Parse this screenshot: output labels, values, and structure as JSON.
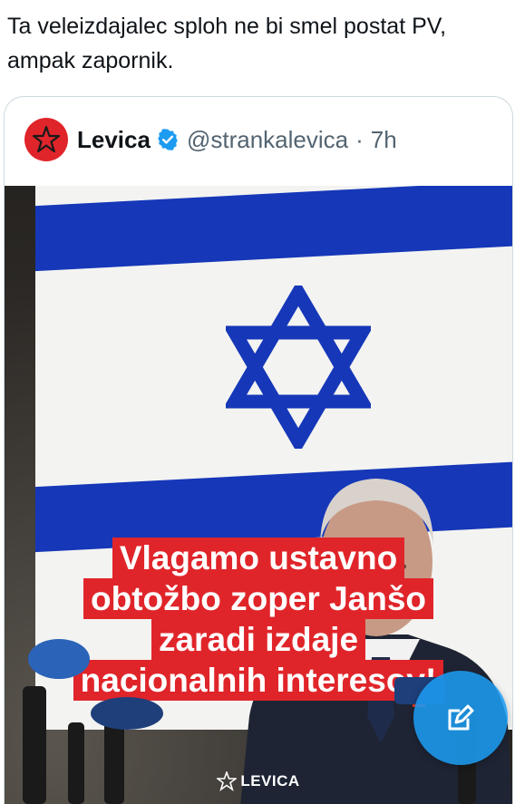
{
  "tweet": {
    "text_line1": "Ta veleizdajalec sploh ne bi smel postat PV,",
    "text_line2": "ampak zapornik."
  },
  "quoted_tweet": {
    "display_name": "Levica",
    "handle": "@strankalevica",
    "separator": "·",
    "time": "7h",
    "avatar_icon": "red-star-logo-icon",
    "verified_icon": "verified-badge-icon",
    "media": {
      "caption_lines": [
        "Vlagamo ustavno",
        "obtožbo zoper Janšo",
        "zaradi izdaje",
        "nacionalnih interesov!"
      ],
      "watermark": "LEVICA",
      "colors": {
        "caption_bg": "#e0252a",
        "flag_blue": "#1537b8"
      }
    }
  },
  "compose_button": {
    "icon": "compose-icon",
    "color": "#1d9bf0"
  }
}
